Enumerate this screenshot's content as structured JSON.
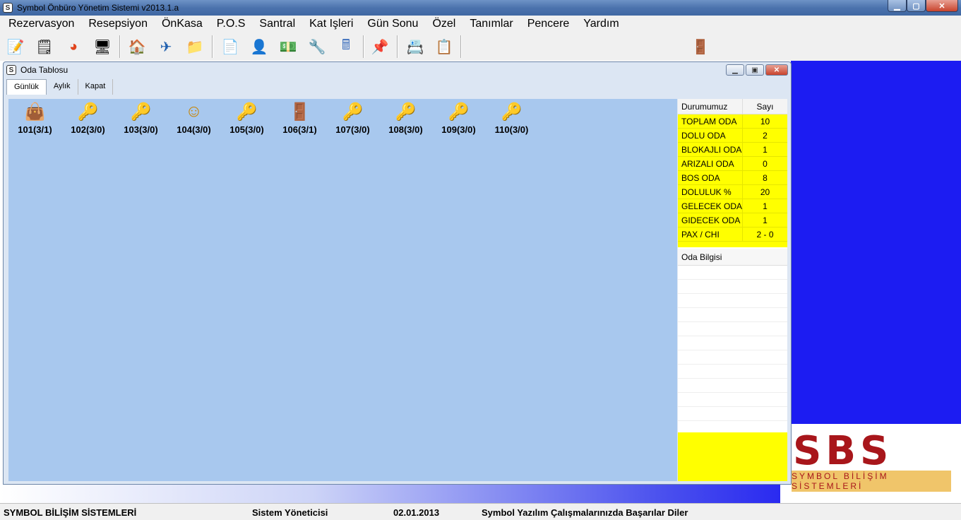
{
  "window": {
    "title": "Symbol Önbüro Yönetim Sistemi v2013.1.a",
    "icon_glyph": "S"
  },
  "menu": [
    {
      "label": "Rezervasyon"
    },
    {
      "label": "Resepsiyon"
    },
    {
      "label": "ÖnKasa"
    },
    {
      "label": "P.O.S"
    },
    {
      "label": "Santral"
    },
    {
      "label": "Kat Işleri"
    },
    {
      "label": "Gün Sonu"
    },
    {
      "label": "Özel"
    },
    {
      "label": "Tanımlar"
    },
    {
      "label": "Pencere"
    },
    {
      "label": "Yardım"
    }
  ],
  "toolbar": {
    "icons": [
      {
        "name": "notebook-pen-icon",
        "glyph": "📝"
      },
      {
        "name": "checklist-icon",
        "glyph": "🗒"
      },
      {
        "name": "pie-chart-icon",
        "glyph": "◕"
      },
      {
        "name": "monitor-icon",
        "glyph": "🖥"
      },
      {
        "name": "home-icon",
        "glyph": "🏠"
      },
      {
        "name": "flight-ticket-icon",
        "glyph": "✈"
      },
      {
        "name": "folder-icon",
        "glyph": "📁"
      },
      {
        "name": "document-icon",
        "glyph": "📄"
      },
      {
        "name": "user-card-icon",
        "glyph": "👤"
      },
      {
        "name": "money-icon",
        "glyph": "💵"
      },
      {
        "name": "tools-icon",
        "glyph": "🔧"
      },
      {
        "name": "calculator-icon",
        "glyph": "🖩"
      },
      {
        "name": "sticky-note-icon",
        "glyph": "📌"
      },
      {
        "name": "directory-icon",
        "glyph": "📇"
      },
      {
        "name": "clipboard-icon",
        "glyph": "📋"
      },
      {
        "name": "exit-door-icon",
        "glyph": "🚪"
      }
    ]
  },
  "oda_tablosu": {
    "title": "Oda Tablosu",
    "icon_glyph": "S",
    "tabs": [
      {
        "label": "Günlük",
        "active": true
      },
      {
        "label": "Aylık",
        "active": false
      },
      {
        "label": "Kapat",
        "active": false
      }
    ],
    "rooms": [
      {
        "label": "101(3/1)",
        "icon": "occupied-bag-icon",
        "glyph": "👜",
        "color": "#d11a1a"
      },
      {
        "label": "102(3/0)",
        "icon": "vacant-key-icon",
        "glyph": "🔑",
        "color": "#2aa84a"
      },
      {
        "label": "103(3/0)",
        "icon": "vacant-key-icon",
        "glyph": "🔑",
        "color": "#2aa84a"
      },
      {
        "label": "104(3/0)",
        "icon": "guest-arriving-icon",
        "glyph": "☺",
        "color": "#c88400"
      },
      {
        "label": "105(3/0)",
        "icon": "vacant-key-icon",
        "glyph": "🔑",
        "color": "#2aa84a"
      },
      {
        "label": "106(3/1)",
        "icon": "departing-exit-icon",
        "glyph": "🚪",
        "color": "#b06a1a"
      },
      {
        "label": "107(3/0)",
        "icon": "vacant-key-icon",
        "glyph": "🔑",
        "color": "#2aa84a"
      },
      {
        "label": "108(3/0)",
        "icon": "vacant-key-icon",
        "glyph": "🔑",
        "color": "#2aa84a"
      },
      {
        "label": "109(3/0)",
        "icon": "vacant-key-icon",
        "glyph": "🔑",
        "color": "#2aa84a"
      },
      {
        "label": "110(3/0)",
        "icon": "vacant-key-icon",
        "glyph": "🔑",
        "color": "#2aa84a"
      }
    ],
    "stats": {
      "col1": "Durumumuz",
      "col2": "Sayı",
      "rows": [
        {
          "label": "TOPLAM ODA",
          "value": "10"
        },
        {
          "label": "DOLU ODA",
          "value": "2"
        },
        {
          "label": "BLOKAJLI ODA",
          "value": "1"
        },
        {
          "label": "ARIZALI ODA",
          "value": "0"
        },
        {
          "label": "BOS ODA",
          "value": "8"
        },
        {
          "label": "DOLULUK %",
          "value": "20"
        },
        {
          "label": "GELECEK ODA",
          "value": "1"
        },
        {
          "label": "GIDECEK ODA",
          "value": "1"
        },
        {
          "label": "PAX / CHI",
          "value": "2 - 0"
        }
      ],
      "info_title": "Oda Bilgisi"
    }
  },
  "logo": {
    "main": "SBS",
    "sub": "SYMBOL BİLİŞİM SİSTEMLERİ"
  },
  "statusbar": {
    "company": "SYMBOL BİLİŞİM SİSTEMLERİ",
    "user": "Sistem Yöneticisi",
    "date": "02.01.2013",
    "message": "Symbol Yazılım Çalışmalarınızda Başarılar Diler"
  },
  "colors": {
    "room_area_bg": "#a8c8ee",
    "stats_yellow": "#ffff00",
    "desktop_blue": "#1c1cf2",
    "logo_red": "#a8161b"
  }
}
